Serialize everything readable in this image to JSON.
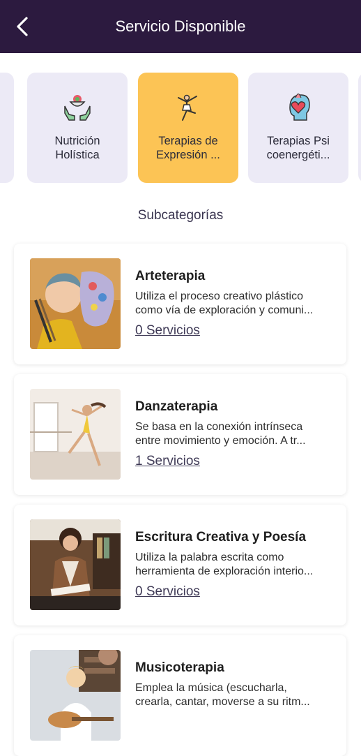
{
  "header": {
    "title": "Servicio Disponible",
    "back_icon": "chevron-left-icon"
  },
  "categories": [
    {
      "label": "Nutrición\nHolística",
      "icon": "hands-bowl-icon"
    },
    {
      "label": "Terapias de\nExpresión ...",
      "icon": "dancer-icon",
      "active": true
    },
    {
      "label": "Terapias Psi\ncoenergéti...",
      "icon": "head-heart-icon"
    }
  ],
  "section_title": "Subcategorías",
  "subcategories": [
    {
      "title": "Arteterapia",
      "desc_line1": "Utiliza el proceso creativo plástico",
      "desc_line2": "como vía de exploración y comuni...",
      "link": "0 Servicios"
    },
    {
      "title": "Danzaterapia",
      "desc_line1": "Se basa en la conexión intrínseca",
      "desc_line2": "entre movimiento y emoción. A tr...",
      "link": "1 Servicios"
    },
    {
      "title": "Escritura Creativa y Poesía",
      "desc_line1": "Utiliza la palabra escrita como",
      "desc_line2": "herramienta de exploración interio...",
      "link": "0 Servicios"
    },
    {
      "title": "Musicoterapia",
      "desc_line1": "Emplea la música (escucharla,",
      "desc_line2": "crearla, cantar, moverse a su ritm...",
      "link": ""
    }
  ],
  "colors": {
    "header_bg": "#2c1a3f",
    "active_category": "#fcc455",
    "inactive_category": "#eceaf6"
  }
}
